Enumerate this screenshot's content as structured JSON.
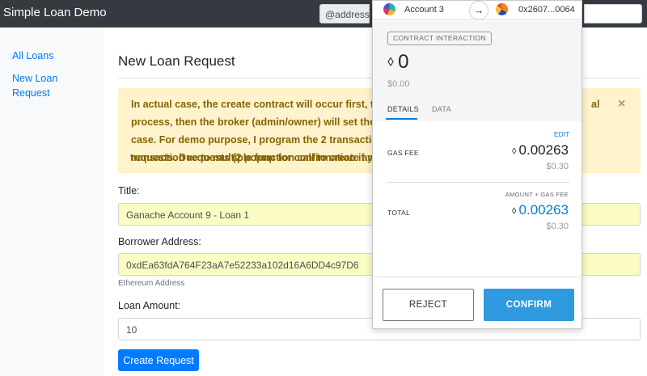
{
  "navbar": {
    "brand": "Simple Loan Demo",
    "address_addon": "@address"
  },
  "sidebar": {
    "items": [
      {
        "label": "All Loans"
      },
      {
        "label": "New Loan Request"
      }
    ]
  },
  "main": {
    "title": "New Loan Request",
    "alert": {
      "lines": [
        "In actual case, the create contract will occur first, the",
        "process, then the broker (admin/owner) will set the r",
        "case. For demo purpose, I program the 2 transaction",
        "requests. Due to multiple function call to create and s",
        "transaction requests (2 popup for confirmation if you"
      ],
      "trailing_text": "al",
      "close_symbol": "×"
    },
    "form": {
      "title_label": "Title:",
      "title_value": "Ganache Account 9 - Loan 1",
      "borrower_label": "Borrower Address:",
      "borrower_value": "0xdEa63fdA764F23aA7e52233a102d16A6DD4c97D6",
      "borrower_help": "Ethereum Address",
      "amount_label": "Loan Amount:",
      "amount_value": "10",
      "submit_label": "Create Request"
    }
  },
  "wallet_popup": {
    "from_account": "Account 3",
    "arrow_symbol": "→",
    "to_address": "0x2607...0064",
    "badge": "CONTRACT INTERACTION",
    "eth_glyph": "⬨",
    "amount_eth": "0",
    "amount_usd": "$0.00",
    "tabs": [
      "DETAILS",
      "DATA"
    ],
    "edit_label": "EDIT",
    "gas_fee": {
      "label": "GAS FEE",
      "eth": "0.00263",
      "usd": "$0.30"
    },
    "total": {
      "sub_label": "AMOUNT + GAS FEE",
      "label": "TOTAL",
      "eth": "0.00263",
      "usd": "$0.30"
    },
    "reject_label": "REJECT",
    "confirm_label": "CONFIRM",
    "accent_color": "#037dd6"
  }
}
